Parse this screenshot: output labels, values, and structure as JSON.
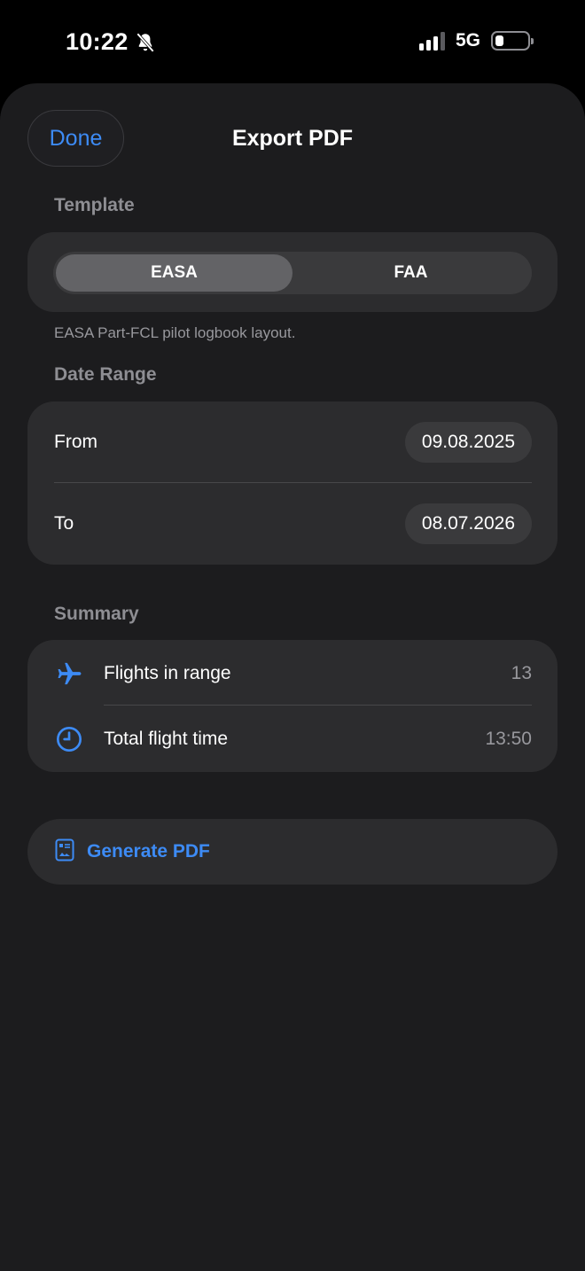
{
  "status_bar": {
    "time": "10:22",
    "network": "5G",
    "battery_level": 0.25
  },
  "sheet": {
    "done_label": "Done",
    "title": "Export PDF"
  },
  "template": {
    "header": "Template",
    "options": [
      "EASA",
      "FAA"
    ],
    "selected": "EASA",
    "footnote": "EASA Part-FCL pilot logbook layout."
  },
  "date_range": {
    "header": "Date Range",
    "from_label": "From",
    "from_value": "09.08.2025",
    "to_label": "To",
    "to_value": "08.07.2026"
  },
  "summary": {
    "header": "Summary",
    "flights_label": "Flights in range",
    "flights_value": "13",
    "flights_icon": "airplane-icon",
    "time_label": "Total flight time",
    "time_value": "13:50",
    "time_icon": "clock-icon"
  },
  "generate": {
    "label": "Generate PDF",
    "icon": "document-icon"
  },
  "colors": {
    "accent": "#3d8bf5",
    "background": "#1c1c1e",
    "card": "#2c2c2e"
  }
}
